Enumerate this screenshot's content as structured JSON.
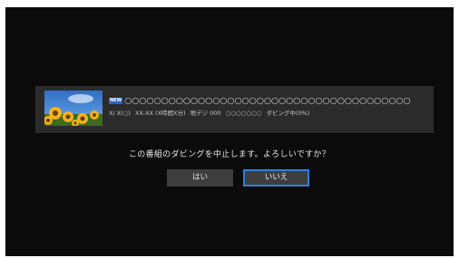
{
  "program": {
    "thumbnail_icon": "sunflower-field-image",
    "new_badge": "NEW",
    "title": "○○○○○○○○○○○○○○○○○○○○○○○○○○○○○○○○○○○○○○○",
    "date": "X/ X(○)",
    "time": "XX:XX (X時間X分)",
    "channel": "地デジ 000",
    "channel_name": "○○○○○○○",
    "status": "ダビング中(0%)"
  },
  "dialog": {
    "message": "この番組のダビングを中止します。よろしいですか？",
    "yes_label": "はい",
    "no_label": "いいえ",
    "selected": "no"
  },
  "colors": {
    "background": "#0b0b0b",
    "panel": "#2b2b2b",
    "button": "#3e3e3e",
    "focus": "#2e80d8",
    "badge": "#2a63c8"
  }
}
